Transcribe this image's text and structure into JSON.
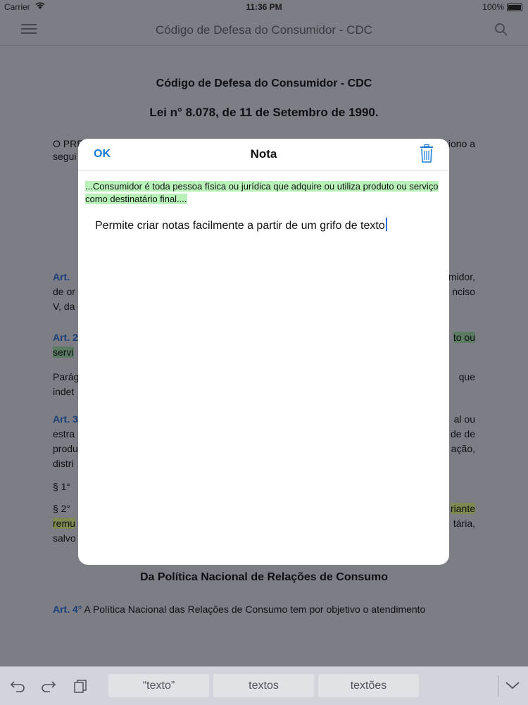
{
  "status": {
    "carrier": "Carrier",
    "time": "11:36 PM",
    "battery": "100%"
  },
  "nav": {
    "title": "Código de Defesa do Consumidor - CDC"
  },
  "doc": {
    "title": "Código de Defesa do Consumidor - CDC",
    "law": "Lei n° 8.078, de 11 de Setembro de 1990.",
    "intro_left": "O PRES",
    "intro_right": "iono a",
    "intro_left_2": "segui",
    "art1_label": "Art.",
    "art1_right": "midor,",
    "art1_left_2": "de or",
    "art1_right_2": "nciso",
    "art1_left_3": "V, da",
    "art2_label": "Art. 2",
    "art2_right": "to ou",
    "art2_left_2": "servi",
    "parag_left": "Parág",
    "parag_right": "que",
    "parag_left_2": "indet",
    "art3_label": "Art. 3",
    "art3_right": "al ou",
    "art3_left_2": "estra",
    "art3_right_2": "de de",
    "art3_left_3": "produ",
    "art3_right_3": "ação,",
    "art3_left_4": "distri",
    "p1_left": "§ 1°",
    "p2_left": "§ 2°",
    "p2_right": "riante",
    "p2_left_2": "remu",
    "p2_right_2": "tária,",
    "p2_left_3": "salvo",
    "chapter_title": "Da Política Nacional de Relações de Consumo",
    "art4_label": "Art. 4°",
    "art4_text": "A Política Nacional das Relações de Consumo tem por objetivo o atendimento"
  },
  "modal": {
    "ok_label": "OK",
    "title": "Nota",
    "quote": "...Consumidor é toda pessoa física ou jurídica que adquire ou utiliza produto ou serviço como destinatário final....",
    "note_text": "Permite criar notas facilmente a partir de um grifo de texto"
  },
  "keyboard": {
    "suggestions": [
      "“texto”",
      "textos",
      "textões"
    ]
  },
  "colors": {
    "accent": "#1a7ad9",
    "highlight": "#b8f2b8"
  }
}
